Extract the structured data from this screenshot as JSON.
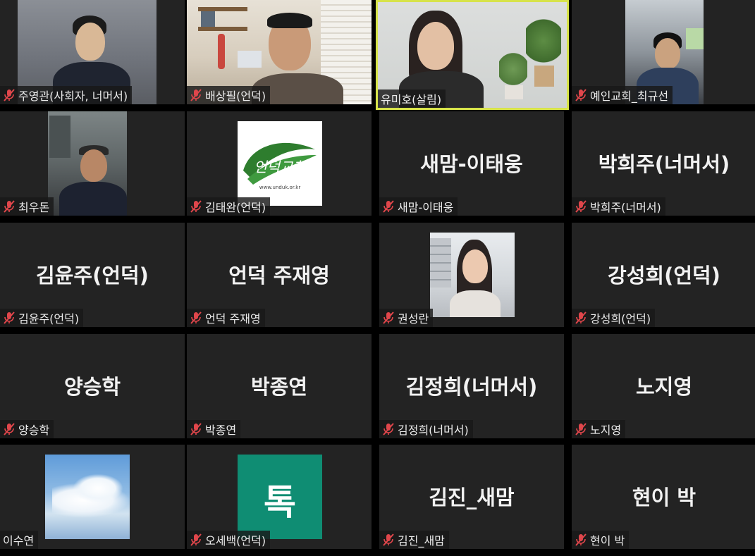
{
  "participants": [
    {
      "name": "주영관(사회자, 너머서)",
      "big": "",
      "type": "video",
      "muted": true
    },
    {
      "name": "배상필(언덕)",
      "big": "",
      "type": "video",
      "muted": true
    },
    {
      "name": "유미호(살림)",
      "big": "",
      "type": "video",
      "muted": false,
      "active": true
    },
    {
      "name": "예인교회_최규선",
      "big": "",
      "type": "video",
      "muted": true
    },
    {
      "name": "최우돈",
      "big": "",
      "type": "video",
      "muted": true
    },
    {
      "name": "김태완(언덕)",
      "big": "",
      "type": "logo",
      "muted": true,
      "logo_text": "언덕교회",
      "logo_url": "www.unduk.or.kr"
    },
    {
      "name": "새맘-이태웅",
      "big": "새맘-이태웅",
      "type": "name",
      "muted": true
    },
    {
      "name": "박희주(너머서)",
      "big": "박희주(너머서)",
      "type": "name",
      "muted": true
    },
    {
      "name": "김윤주(언덕)",
      "big": "김윤주(언덕)",
      "type": "name",
      "muted": true
    },
    {
      "name": "언덕 주재영",
      "big": "언덕 주재영",
      "type": "name",
      "muted": true
    },
    {
      "name": "권성란",
      "big": "",
      "type": "photo",
      "muted": true
    },
    {
      "name": "강성희(언덕)",
      "big": "강성희(언덕)",
      "type": "name",
      "muted": true
    },
    {
      "name": "양승학",
      "big": "양승학",
      "type": "name",
      "muted": true
    },
    {
      "name": "박종연",
      "big": "박종연",
      "type": "name",
      "muted": true
    },
    {
      "name": "김정희(너머서)",
      "big": "김정희(너머서)",
      "type": "name",
      "muted": true
    },
    {
      "name": "노지영",
      "big": "노지영",
      "type": "name",
      "muted": true
    },
    {
      "name": "이수연",
      "big": "",
      "type": "sky",
      "muted": false
    },
    {
      "name": "오세백(언덕)",
      "big": "",
      "type": "tok",
      "muted": true,
      "tok_text": "톡"
    },
    {
      "name": "김진_새맘",
      "big": "김진_새맘",
      "type": "name",
      "muted": true
    },
    {
      "name": "현이 박",
      "big": "현이 박",
      "type": "name",
      "muted": true
    }
  ],
  "colors": {
    "tile": "#232323",
    "active_border": "#d7e34a",
    "muted_icon": "#e0464b",
    "logo_green": "#2e7d2e",
    "tok": "#0f8d73"
  },
  "icons": {
    "muted": "muted-microphone-icon"
  }
}
